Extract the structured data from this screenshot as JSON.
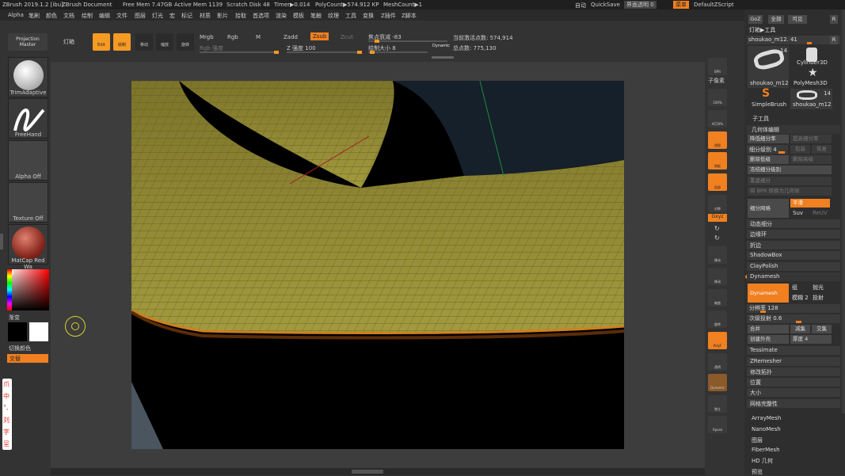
{
  "titlebar": {
    "app": "ZBrush 2019.1.2 [ibu]",
    "doc": "ZBrush Document",
    "free_mem": "Free Mem 7.47GB",
    "active_mem": "Active Mem 1139",
    "scratch": "Scratch Disk 48",
    "timer": "Timer▶0.014",
    "polycount": "PolyCount▶574.912 KP",
    "meshcount": "MeshCount▶1",
    "auto": "自动",
    "quicksave": "QuickSave",
    "transparency": "界面透明 0",
    "menu": "菜单",
    "script": "DefaultZScript"
  },
  "menu": [
    "Alpha",
    "笔刷",
    "颜色",
    "文档",
    "绘制",
    "编辑",
    "文件",
    "图层",
    "灯光",
    "宏",
    "标记",
    "材质",
    "影片",
    "拾取",
    "首选项",
    "渲染",
    "模板",
    "笔触",
    "纹理",
    "工具",
    "变换",
    "Z插件",
    "Z脚本"
  ],
  "toolbar": {
    "projection_master": "Projection Master",
    "lightbox": "灯箱",
    "edit": "Edit",
    "draw": "绘制",
    "move": "移动",
    "scale": "缩放",
    "rotate": "旋转",
    "mrgb": "Mrgb",
    "rgb": "Rgb",
    "m": "M",
    "zadd": "Zadd",
    "zsub": "Zsub",
    "zcut": "Zcut",
    "rgb_intensity": "Rgb 强度",
    "z_intensity": "Z 强度 100",
    "focal_shift": "焦点衰减 -83",
    "draw_size": "绘制大小 8",
    "dynamic": "Dynamic",
    "active_points": "当前激活点数: 574,914",
    "total_points": "总点数: 775,130"
  },
  "leftpanel": {
    "brush": "TrimAdaptive",
    "stroke": "FreeHand",
    "alpha": "Alpha Off",
    "texture": "Texture Off",
    "material": "MatCap Red Wa",
    "gradient": "渐变",
    "switch_color": "切换颜色",
    "alternate": "交替"
  },
  "rightshelf": [
    "BPR",
    "子像素",
    "100%",
    "AC50%",
    "透视",
    "地板",
    "局部",
    "对称",
    "Gxyz",
    "移动",
    "缩放",
    "旋转",
    "PolyF",
    "透明",
    "Dynamic",
    "独立",
    "Xpose"
  ],
  "tool": {
    "goz": "GoZ",
    "all": "全部",
    "visible": "可见",
    "r": "R",
    "lightbox_tool": "灯箱▶工具",
    "current": "shoukao_m12. 41",
    "thumb1": "shoukao_m12",
    "thumb1_count": "14",
    "thumb2": "Cylinder3D",
    "thumb3": "PolyMesh3D",
    "thumb4": "SimpleBrush",
    "thumb5": "shoukao_m12",
    "thumb5_count": "14"
  },
  "geometry_panel": {
    "subtool": "子工具",
    "geometry": "几何体编辑",
    "lower_res": "降低细分率",
    "higher_res": "提高细分率",
    "sdiv": "细分级别 4",
    "cage": "包装",
    "rstr": "恢复",
    "del_lower": "删除低级",
    "del_higher": "删除高级",
    "freeze": "冻结细分级别",
    "reconstruct": "重建细分",
    "bpr_convert": "将 BPR 转换为几何体",
    "divide": "细分网格",
    "smooth": "平滑",
    "suv": "Suv",
    "reuv": "ReUV",
    "dynamic_subdiv": "动态细分",
    "edgeloop": "边缘环",
    "crease": "折边",
    "shadowbox": "ShadowBox",
    "claypolish": "ClayPolish",
    "dynamesh_header": "Dynamesh",
    "dynamesh_btn": "Dynamesh",
    "group": "组",
    "polish": "抛光",
    "blur": "模糊 2",
    "project": "投射",
    "resolution": "分辨率 128",
    "subproject": "次级投射 0.6",
    "merge": "合并",
    "subtract": "减集",
    "intersect": "交集",
    "create_shell": "创建外壳",
    "thickness": "厚度 4",
    "tessimate": "Tessimate",
    "zremesher": "ZRemesher",
    "modify_topology": "修改拓扑",
    "position": "位置",
    "size": "大小",
    "mesh_integrity": "网格完整性"
  },
  "lower_list": [
    "ArrayMesh",
    "NanoMesh",
    "图层",
    "FiberMesh",
    "HD 几何",
    "预览"
  ],
  "left_icons": [
    "爪",
    "中",
    "°,",
    "刘",
    "字",
    "呈"
  ]
}
